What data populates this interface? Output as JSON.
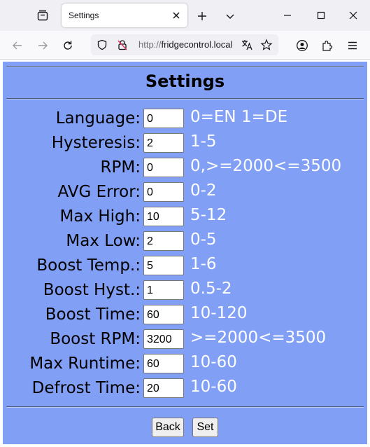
{
  "browser": {
    "tab_title": "Settings",
    "url_protocol": "http://",
    "url_host": "fridgecontrol.local"
  },
  "page": {
    "title": "Settings",
    "rows": [
      {
        "label": "Language:",
        "value": "0",
        "hint": "0=EN 1=DE"
      },
      {
        "label": "Hysteresis:",
        "value": "2",
        "hint": "1-5"
      },
      {
        "label": "RPM:",
        "value": "0",
        "hint": "0,>=2000<=3500"
      },
      {
        "label": "AVG Error:",
        "value": "0",
        "hint": "0-2"
      },
      {
        "label": "Max High:",
        "value": "10",
        "hint": "5-12"
      },
      {
        "label": "Max Low:",
        "value": "2",
        "hint": "0-5"
      },
      {
        "label": "Boost Temp.:",
        "value": "5",
        "hint": "1-6"
      },
      {
        "label": "Boost Hyst.:",
        "value": "1",
        "hint": "0.5-2"
      },
      {
        "label": "Boost Time:",
        "value": "60",
        "hint": "10-120"
      },
      {
        "label": "Boost RPM:",
        "value": "3200",
        "hint": ">=2000<=3500"
      },
      {
        "label": "Max Runtime:",
        "value": "60",
        "hint": "10-60"
      },
      {
        "label": "Defrost Time:",
        "value": "20",
        "hint": "10-60"
      }
    ],
    "back_label": "Back",
    "set_label": "Set"
  },
  "colors": {
    "panel_bg": "#809ff5",
    "hint_text": "#ffffff"
  }
}
